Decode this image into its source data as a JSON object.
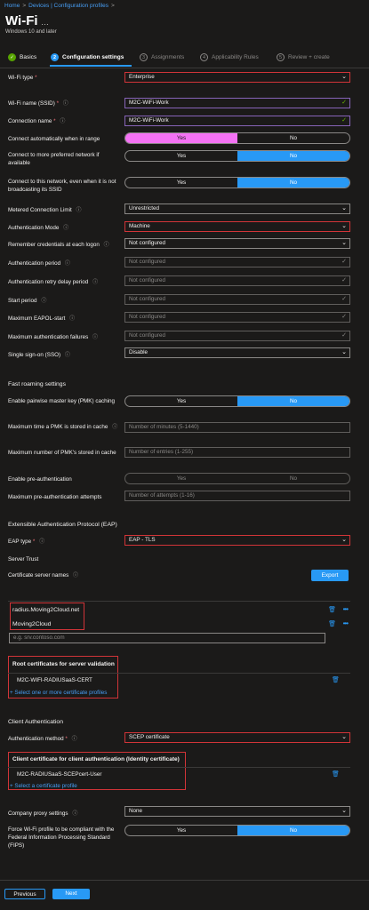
{
  "breadcrumb": [
    "Home",
    "Devices | Configuration profiles"
  ],
  "page": {
    "title": "Wi-Fi",
    "subtitle": "Windows 10 and later"
  },
  "steps": [
    {
      "num": "✓",
      "label": "Basics"
    },
    {
      "num": "2",
      "label": "Configuration settings"
    },
    {
      "num": "3",
      "label": "Assignments"
    },
    {
      "num": "4",
      "label": "Applicability Rules"
    },
    {
      "num": "5",
      "label": "Review + create"
    }
  ],
  "settings": {
    "wifi_type": {
      "label": "Wi-Fi type",
      "value": "Enterprise"
    },
    "ssid": {
      "label": "Wi-Fi name (SSID)",
      "value": "M2C-WiFi-Work"
    },
    "conn_name": {
      "label": "Connection name",
      "value": "M2C-WiFi-Work"
    },
    "auto_connect": {
      "label": "Connect automatically when in range",
      "yes": "Yes",
      "no": "No"
    },
    "preferred": {
      "label": "Connect to more preferred network if available",
      "yes": "Yes",
      "no": "No"
    },
    "hidden": {
      "label": "Connect to this network, even when it is not broadcasting its SSID",
      "yes": "Yes",
      "no": "No"
    },
    "metered": {
      "label": "Metered Connection Limit",
      "value": "Unrestricted"
    },
    "auth_mode": {
      "label": "Authentication Mode",
      "value": "Machine"
    },
    "remember": {
      "label": "Remember credentials at each logon",
      "value": "Not configured"
    },
    "auth_period": {
      "label": "Authentication period",
      "value": "Not configured"
    },
    "retry_delay": {
      "label": "Authentication retry delay period",
      "value": "Not configured"
    },
    "start_period": {
      "label": "Start period",
      "value": "Not configured"
    },
    "eapol": {
      "label": "Maximum EAPOL-start",
      "value": "Not configured"
    },
    "max_failures": {
      "label": "Maximum authentication failures",
      "value": "Not configured"
    },
    "sso": {
      "label": "Single sign-on (SSO)",
      "value": "Disable"
    }
  },
  "fast_roaming": {
    "heading": "Fast roaming settings",
    "pmk": {
      "label": "Enable pairwise master key (PMK) caching",
      "yes": "Yes",
      "no": "No"
    },
    "pmk_time": {
      "label": "Maximum time a PMK is stored in cache",
      "placeholder": "Number of minutes (5-1440)"
    },
    "pmk_count": {
      "label": "Maximum number of PMK's stored in cache",
      "placeholder": "Number of entries (1-255)"
    },
    "preauth": {
      "label": "Enable pre-authentication",
      "yes": "Yes",
      "no": "No"
    },
    "preauth_attempts": {
      "label": "Maximum pre-authentication attempts",
      "placeholder": "Number of attempts (1-16)"
    }
  },
  "eap": {
    "heading": "Extensible Authentication Protocol (EAP)",
    "type": {
      "label": "EAP type",
      "value": "EAP - TLS"
    },
    "server_trust": "Server Trust",
    "cert_names_label": "Certificate server names",
    "export": "Export",
    "server_names": [
      "radius.Moving2Cloud.net",
      "Moving2Cloud"
    ],
    "new_placeholder": "e.g. srv.contoso.com",
    "root_heading": "Root certificates for server validation",
    "root_cert": "M2C-WIFI-RADIUSaaS-CERT",
    "root_add": "+ Select one or more certificate profiles"
  },
  "client_auth": {
    "heading": "Client Authentication",
    "method": {
      "label": "Authentication method",
      "value": "SCEP certificate"
    },
    "cert_heading": "Client certificate for client authentication (Identity certificate)",
    "cert": "M2C-RADIUSaaS-SCEPcert-User",
    "cert_add": "+ Select a certificate profile"
  },
  "proxy": {
    "label": "Company proxy settings",
    "value": "None"
  },
  "fips": {
    "label": "Force Wi-Fi profile to be compliant with the Federal Information Processing Standard (FIPS)",
    "yes": "Yes",
    "no": "No"
  },
  "footer": {
    "previous": "Previous",
    "next": "Next"
  },
  "colors": {
    "accent": "#2899f5",
    "required_border": "#d13438",
    "pink_toggle": "#f472f4",
    "success": "#57a300"
  }
}
